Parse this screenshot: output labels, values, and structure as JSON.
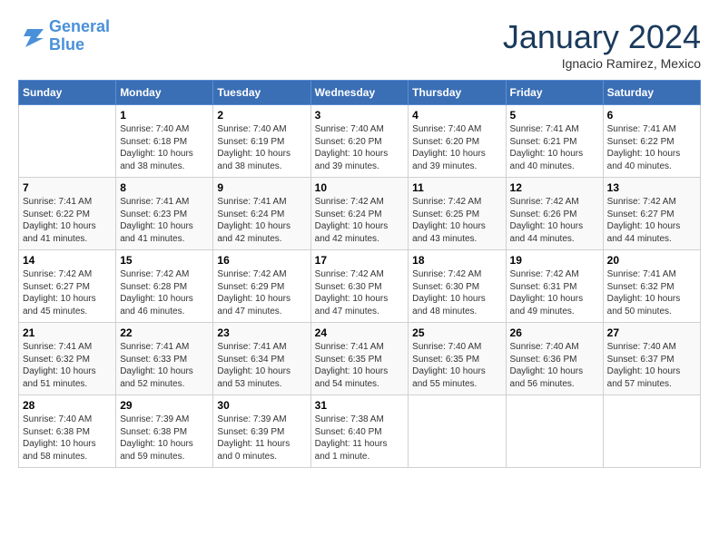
{
  "logo": {
    "line1": "General",
    "line2": "Blue"
  },
  "title": "January 2024",
  "subtitle": "Ignacio Ramirez, Mexico",
  "days_header": [
    "Sunday",
    "Monday",
    "Tuesday",
    "Wednesday",
    "Thursday",
    "Friday",
    "Saturday"
  ],
  "weeks": [
    [
      {
        "day": "",
        "info": ""
      },
      {
        "day": "1",
        "info": "Sunrise: 7:40 AM\nSunset: 6:18 PM\nDaylight: 10 hours\nand 38 minutes."
      },
      {
        "day": "2",
        "info": "Sunrise: 7:40 AM\nSunset: 6:19 PM\nDaylight: 10 hours\nand 38 minutes."
      },
      {
        "day": "3",
        "info": "Sunrise: 7:40 AM\nSunset: 6:20 PM\nDaylight: 10 hours\nand 39 minutes."
      },
      {
        "day": "4",
        "info": "Sunrise: 7:40 AM\nSunset: 6:20 PM\nDaylight: 10 hours\nand 39 minutes."
      },
      {
        "day": "5",
        "info": "Sunrise: 7:41 AM\nSunset: 6:21 PM\nDaylight: 10 hours\nand 40 minutes."
      },
      {
        "day": "6",
        "info": "Sunrise: 7:41 AM\nSunset: 6:22 PM\nDaylight: 10 hours\nand 40 minutes."
      }
    ],
    [
      {
        "day": "7",
        "info": "Sunrise: 7:41 AM\nSunset: 6:22 PM\nDaylight: 10 hours\nand 41 minutes."
      },
      {
        "day": "8",
        "info": "Sunrise: 7:41 AM\nSunset: 6:23 PM\nDaylight: 10 hours\nand 41 minutes."
      },
      {
        "day": "9",
        "info": "Sunrise: 7:41 AM\nSunset: 6:24 PM\nDaylight: 10 hours\nand 42 minutes."
      },
      {
        "day": "10",
        "info": "Sunrise: 7:42 AM\nSunset: 6:24 PM\nDaylight: 10 hours\nand 42 minutes."
      },
      {
        "day": "11",
        "info": "Sunrise: 7:42 AM\nSunset: 6:25 PM\nDaylight: 10 hours\nand 43 minutes."
      },
      {
        "day": "12",
        "info": "Sunrise: 7:42 AM\nSunset: 6:26 PM\nDaylight: 10 hours\nand 44 minutes."
      },
      {
        "day": "13",
        "info": "Sunrise: 7:42 AM\nSunset: 6:27 PM\nDaylight: 10 hours\nand 44 minutes."
      }
    ],
    [
      {
        "day": "14",
        "info": "Sunrise: 7:42 AM\nSunset: 6:27 PM\nDaylight: 10 hours\nand 45 minutes."
      },
      {
        "day": "15",
        "info": "Sunrise: 7:42 AM\nSunset: 6:28 PM\nDaylight: 10 hours\nand 46 minutes."
      },
      {
        "day": "16",
        "info": "Sunrise: 7:42 AM\nSunset: 6:29 PM\nDaylight: 10 hours\nand 47 minutes."
      },
      {
        "day": "17",
        "info": "Sunrise: 7:42 AM\nSunset: 6:30 PM\nDaylight: 10 hours\nand 47 minutes."
      },
      {
        "day": "18",
        "info": "Sunrise: 7:42 AM\nSunset: 6:30 PM\nDaylight: 10 hours\nand 48 minutes."
      },
      {
        "day": "19",
        "info": "Sunrise: 7:42 AM\nSunset: 6:31 PM\nDaylight: 10 hours\nand 49 minutes."
      },
      {
        "day": "20",
        "info": "Sunrise: 7:41 AM\nSunset: 6:32 PM\nDaylight: 10 hours\nand 50 minutes."
      }
    ],
    [
      {
        "day": "21",
        "info": "Sunrise: 7:41 AM\nSunset: 6:32 PM\nDaylight: 10 hours\nand 51 minutes."
      },
      {
        "day": "22",
        "info": "Sunrise: 7:41 AM\nSunset: 6:33 PM\nDaylight: 10 hours\nand 52 minutes."
      },
      {
        "day": "23",
        "info": "Sunrise: 7:41 AM\nSunset: 6:34 PM\nDaylight: 10 hours\nand 53 minutes."
      },
      {
        "day": "24",
        "info": "Sunrise: 7:41 AM\nSunset: 6:35 PM\nDaylight: 10 hours\nand 54 minutes."
      },
      {
        "day": "25",
        "info": "Sunrise: 7:40 AM\nSunset: 6:35 PM\nDaylight: 10 hours\nand 55 minutes."
      },
      {
        "day": "26",
        "info": "Sunrise: 7:40 AM\nSunset: 6:36 PM\nDaylight: 10 hours\nand 56 minutes."
      },
      {
        "day": "27",
        "info": "Sunrise: 7:40 AM\nSunset: 6:37 PM\nDaylight: 10 hours\nand 57 minutes."
      }
    ],
    [
      {
        "day": "28",
        "info": "Sunrise: 7:40 AM\nSunset: 6:38 PM\nDaylight: 10 hours\nand 58 minutes."
      },
      {
        "day": "29",
        "info": "Sunrise: 7:39 AM\nSunset: 6:38 PM\nDaylight: 10 hours\nand 59 minutes."
      },
      {
        "day": "30",
        "info": "Sunrise: 7:39 AM\nSunset: 6:39 PM\nDaylight: 11 hours\nand 0 minutes."
      },
      {
        "day": "31",
        "info": "Sunrise: 7:38 AM\nSunset: 6:40 PM\nDaylight: 11 hours\nand 1 minute."
      },
      {
        "day": "",
        "info": ""
      },
      {
        "day": "",
        "info": ""
      },
      {
        "day": "",
        "info": ""
      }
    ]
  ]
}
